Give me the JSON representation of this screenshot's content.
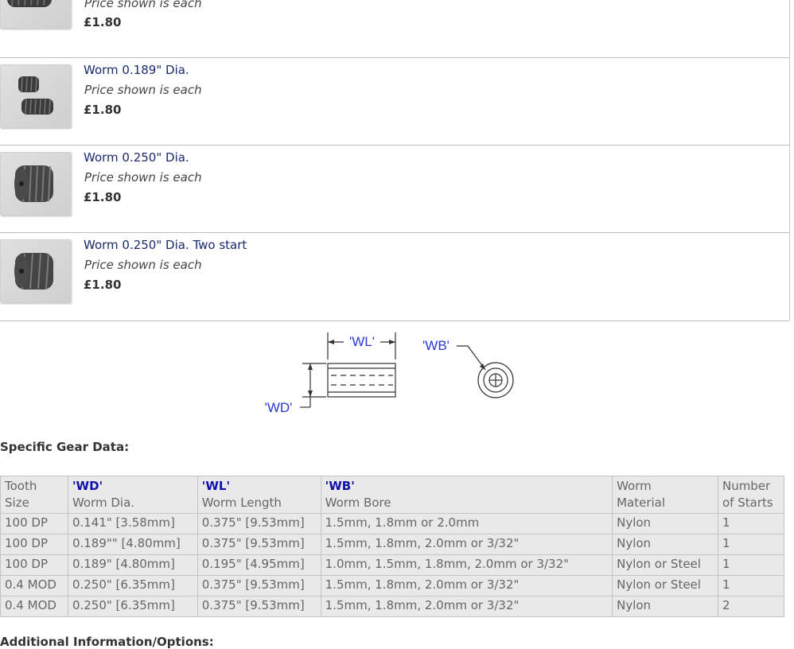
{
  "products": [
    {
      "title": "",
      "note": "Price shown is each",
      "price": "£1.80"
    },
    {
      "title": "Worm 0.189\" Dia.",
      "note": "Price shown is each",
      "price": "£1.80"
    },
    {
      "title": "Worm 0.250\" Dia.",
      "note": "Price shown is each",
      "price": "£1.80"
    },
    {
      "title": "Worm 0.250\" Dia. Two start",
      "note": "Price shown is each",
      "price": "£1.80"
    }
  ],
  "diagram": {
    "wl_label": "'WL'",
    "wb_label": "'WB'",
    "wd_label": "'WD'"
  },
  "section_heading": "Specific Gear Data:",
  "table": {
    "headers": [
      {
        "bold": "",
        "line1": "Tooth",
        "line2": "Size"
      },
      {
        "bold": "'WD'",
        "line1": "",
        "line2": "Worm Dia."
      },
      {
        "bold": "'WL'",
        "line1": "",
        "line2": "Worm Length"
      },
      {
        "bold": "'WB'",
        "line1": "",
        "line2": "Worm Bore"
      },
      {
        "bold": "",
        "line1": "Worm",
        "line2": "Material"
      },
      {
        "bold": "",
        "line1": "Number",
        "line2": "of Starts"
      }
    ],
    "rows": [
      [
        "100 DP",
        "0.141\" [3.58mm]",
        "0.375\" [9.53mm]",
        "1.5mm, 1.8mm or 2.0mm",
        "Nylon",
        "1"
      ],
      [
        "100 DP",
        "0.189\"\" [4.80mm]",
        "0.375\" [9.53mm]",
        "1.5mm, 1.8mm, 2.0mm or 3/32\"",
        "Nylon",
        "1"
      ],
      [
        "100 DP",
        "0.189\" [4.80mm]",
        "0.195\" [4.95mm]",
        "1.0mm, 1.5mm, 1.8mm, 2.0mm or 3/32\"",
        "Nylon or Steel",
        "1"
      ],
      [
        "0.4 MOD",
        "0.250\" [6.35mm]",
        "0.375\" [9.53mm]",
        "1.5mm, 1.8mm, 2.0mm or 3/32\"",
        "Nylon or Steel",
        "1"
      ],
      [
        "0.4 MOD",
        "0.250\" [6.35mm]",
        "0.375\" [9.53mm]",
        "1.5mm, 1.8mm, 2.0mm or 3/32\"",
        "Nylon",
        "2"
      ]
    ]
  },
  "footer_heading": "Additional Information/Options:"
}
